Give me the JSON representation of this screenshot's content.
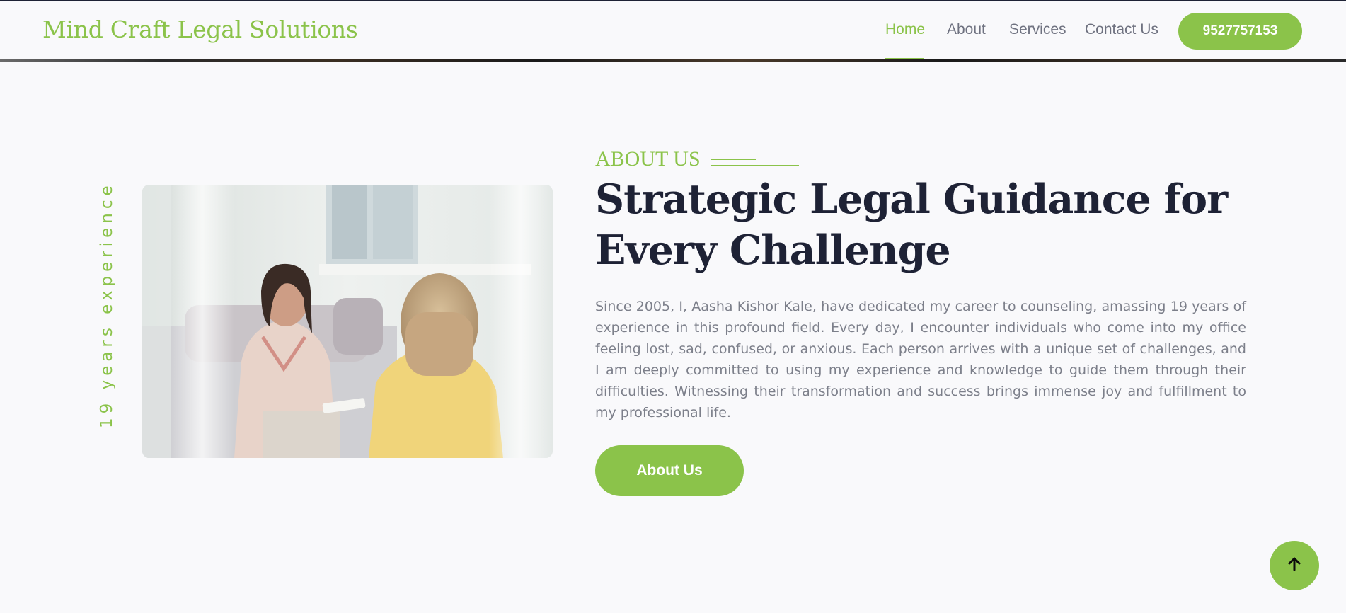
{
  "header": {
    "brand": "Mind Craft Legal Solutions",
    "nav": [
      {
        "label": "Home",
        "active": true
      },
      {
        "label": "About",
        "active": false
      },
      {
        "label": "Services",
        "active": false
      },
      {
        "label": "Contact Us",
        "active": false
      }
    ],
    "phone_button": "9527757153"
  },
  "about": {
    "vertical_label": "19 years experience",
    "eyebrow": "ABOUT US",
    "headline_line1": "Strategic Legal Guidance for",
    "headline_line2": "Every Challenge",
    "body": "Since 2005, I, Aasha Kishor Kale, have dedicated my career to counseling, amassing 19 years of experience in this profound field. Every day, I encounter individuals who come into my office feeling lost, sad, confused, or anxious. Each person arrives with a unique set of challenges, and I am deeply committed to using my experience and knowledge to guide them through their difficulties. Witnessing their transformation and success brings immense joy and fulfillment to my professional life.",
    "button": "About Us"
  },
  "icons": {
    "scroll_top": "arrow-up-icon"
  },
  "colors": {
    "accent": "#8bc34a",
    "heading": "#1e2235",
    "body_text": "#7c7f8a",
    "nav_text": "#6f7280",
    "background": "#f9f9fb"
  }
}
